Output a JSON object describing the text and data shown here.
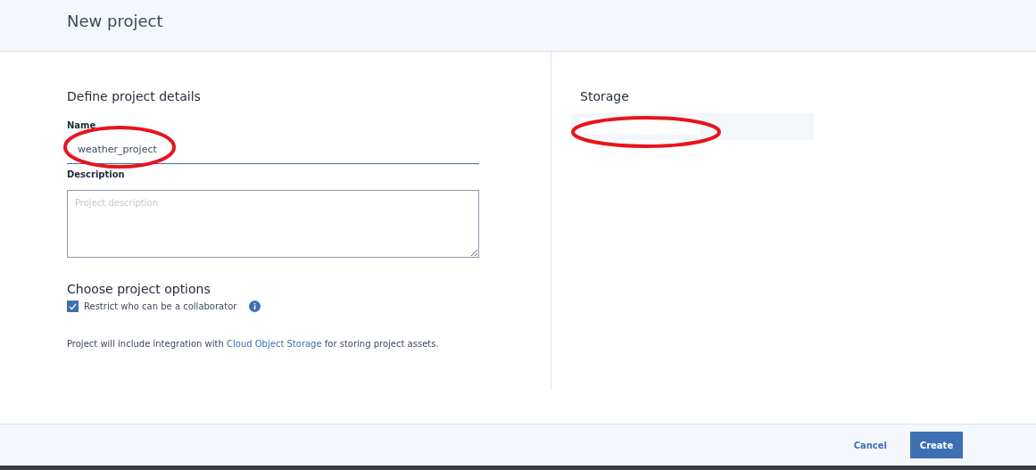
{
  "header": {
    "title": "New project"
  },
  "details": {
    "heading": "Define project details",
    "name_field": {
      "label": "Name",
      "value": "weather_project",
      "focused": true,
      "circled": true
    },
    "description_field": {
      "label": "Description",
      "placeholder": "Project description"
    }
  },
  "options": {
    "heading": "Choose project options",
    "checkboxes": [
      {
        "label": "Restrict who can be a collaborator",
        "checked": true,
        "info": true
      }
    ],
    "note": {
      "before": "Project will include integration with ",
      "link": "Cloud Object Storage",
      "after": " for storing project assets."
    }
  },
  "storage": {
    "heading": "Storage",
    "circled": true
  },
  "footer": {
    "buttons": [
      {
        "label": "Cancel",
        "kind": "secondary"
      },
      {
        "label": "Create",
        "kind": "primary"
      }
    ]
  }
}
